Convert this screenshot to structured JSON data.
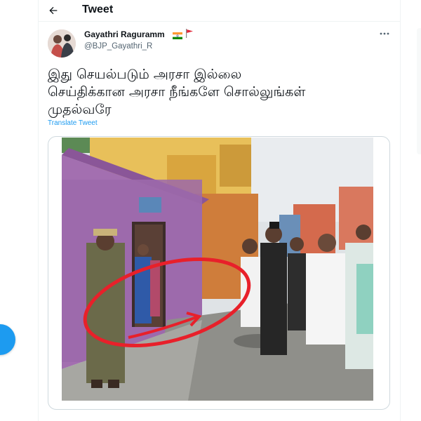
{
  "header": {
    "title": "Tweet",
    "back_icon": "arrow-left-icon"
  },
  "tweet": {
    "author_name": "Gayathri Raguramm",
    "author_handle": "@BJP_Gayathri_R",
    "badges": [
      "india-flag-icon",
      "red-flag-icon"
    ],
    "more_icon": "more-horizontal-icon",
    "text_lines": [
      "இது செயல்படும் அரசா இல்லை",
      "செய்திக்கான அரசா நீங்களே சொல்லுங்கள்",
      "முதல்வரே"
    ],
    "translate_label": "Translate Tweet"
  },
  "colors": {
    "accent": "#1d9bf0",
    "text_primary": "#0f1419",
    "text_secondary": "#536471",
    "border": "#cfd9de",
    "annotation_circle": "#e8202a"
  }
}
